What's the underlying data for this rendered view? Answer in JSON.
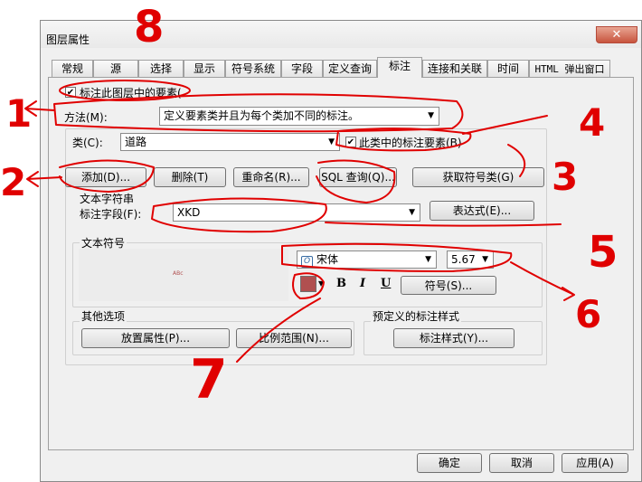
{
  "window": {
    "title": "图层属性",
    "close_glyph": "✕"
  },
  "tabs": [
    {
      "label": "常规"
    },
    {
      "label": "源"
    },
    {
      "label": "选择"
    },
    {
      "label": "显示"
    },
    {
      "label": "符号系统"
    },
    {
      "label": "字段"
    },
    {
      "label": "定义查询"
    },
    {
      "label": "标注"
    },
    {
      "label": "连接和关联"
    },
    {
      "label": "时间"
    },
    {
      "label": "HTML 弹出窗口"
    }
  ],
  "active_tab": "标注",
  "label_features": {
    "label": "标注此图层中的要素(",
    "checked": true
  },
  "method": {
    "label": "方法(M):",
    "value": "定义要素类并且为每个类加不同的标注。"
  },
  "class_row": {
    "label": "类(C):",
    "value": "道路",
    "label_class_checkbox": {
      "label": "此类中的标注要素(B)",
      "checked": true
    }
  },
  "class_buttons": {
    "add": "添加(D)...",
    "delete": "删除(T)",
    "rename": "重命名(R)...",
    "sql_query": "SQL 查询(Q)...",
    "get_classes": "获取符号类(G)"
  },
  "text_string": {
    "group_label": "文本字符串",
    "field_label": "标注字段(F):",
    "field_value": "XKD",
    "expression_button": "表达式(E)..."
  },
  "text_symbol": {
    "group_label": "文本符号",
    "preview_text": "ABc",
    "font": "宋体",
    "size": "5.67",
    "bold": "B",
    "italic": "I",
    "underline": "U",
    "symbol_button": "符号(S)...",
    "color": "#b05050"
  },
  "other_options": {
    "group_label": "其他选项",
    "placement_button": "放置属性(P)...",
    "scale_button": "比例范围(N)..."
  },
  "predefined": {
    "group_label": "预定义的标注样式",
    "style_button": "标注样式(Y)..."
  },
  "footer": {
    "ok": "确定",
    "cancel": "取消",
    "apply": "应用(A)"
  },
  "annotations": {
    "color": "#e00000",
    "numbers": [
      "8",
      "1",
      "2",
      "4",
      "3",
      "5",
      "6",
      "7"
    ]
  }
}
